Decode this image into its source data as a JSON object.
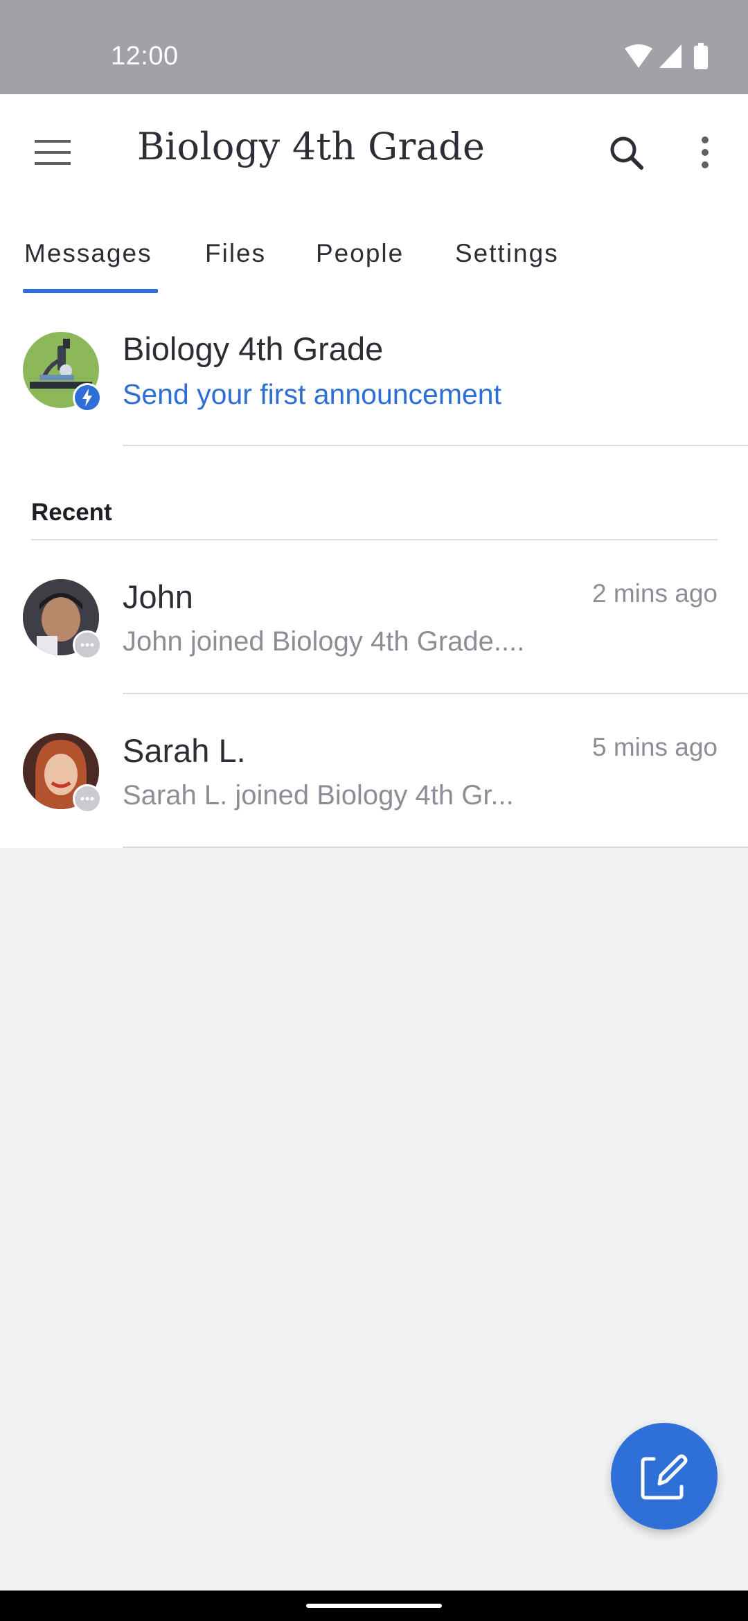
{
  "status_bar": {
    "time": "12:00",
    "icons": [
      "wifi-icon",
      "signal-icon",
      "battery-icon"
    ]
  },
  "app_bar": {
    "title": "Biology 4th Grade",
    "menu_icon": "hamburger-menu-icon",
    "search_icon": "search-icon",
    "more_icon": "more-vertical-icon"
  },
  "tabs": [
    {
      "label": "Messages",
      "selected": true
    },
    {
      "label": "Files",
      "selected": false
    },
    {
      "label": "People",
      "selected": false
    },
    {
      "label": "Settings",
      "selected": false
    }
  ],
  "announcement": {
    "title": "Biology 4th Grade",
    "link_text": "Send your first announcement",
    "avatar_icon": "microscope-icon",
    "badge_icon": "lightning-icon"
  },
  "recent": {
    "label": "Recent",
    "items": [
      {
        "name": "John",
        "preview": "John joined Biology 4th Grade....",
        "time": "2 mins ago"
      },
      {
        "name": "Sarah L.",
        "preview": "Sarah L. joined Biology 4th Gr...",
        "time": "5 mins ago"
      }
    ]
  },
  "fab": {
    "icon": "compose-icon"
  },
  "colors": {
    "accent": "#2D6FD6",
    "status_bar": "#A1A2A7",
    "background": "#F1F2F4"
  }
}
